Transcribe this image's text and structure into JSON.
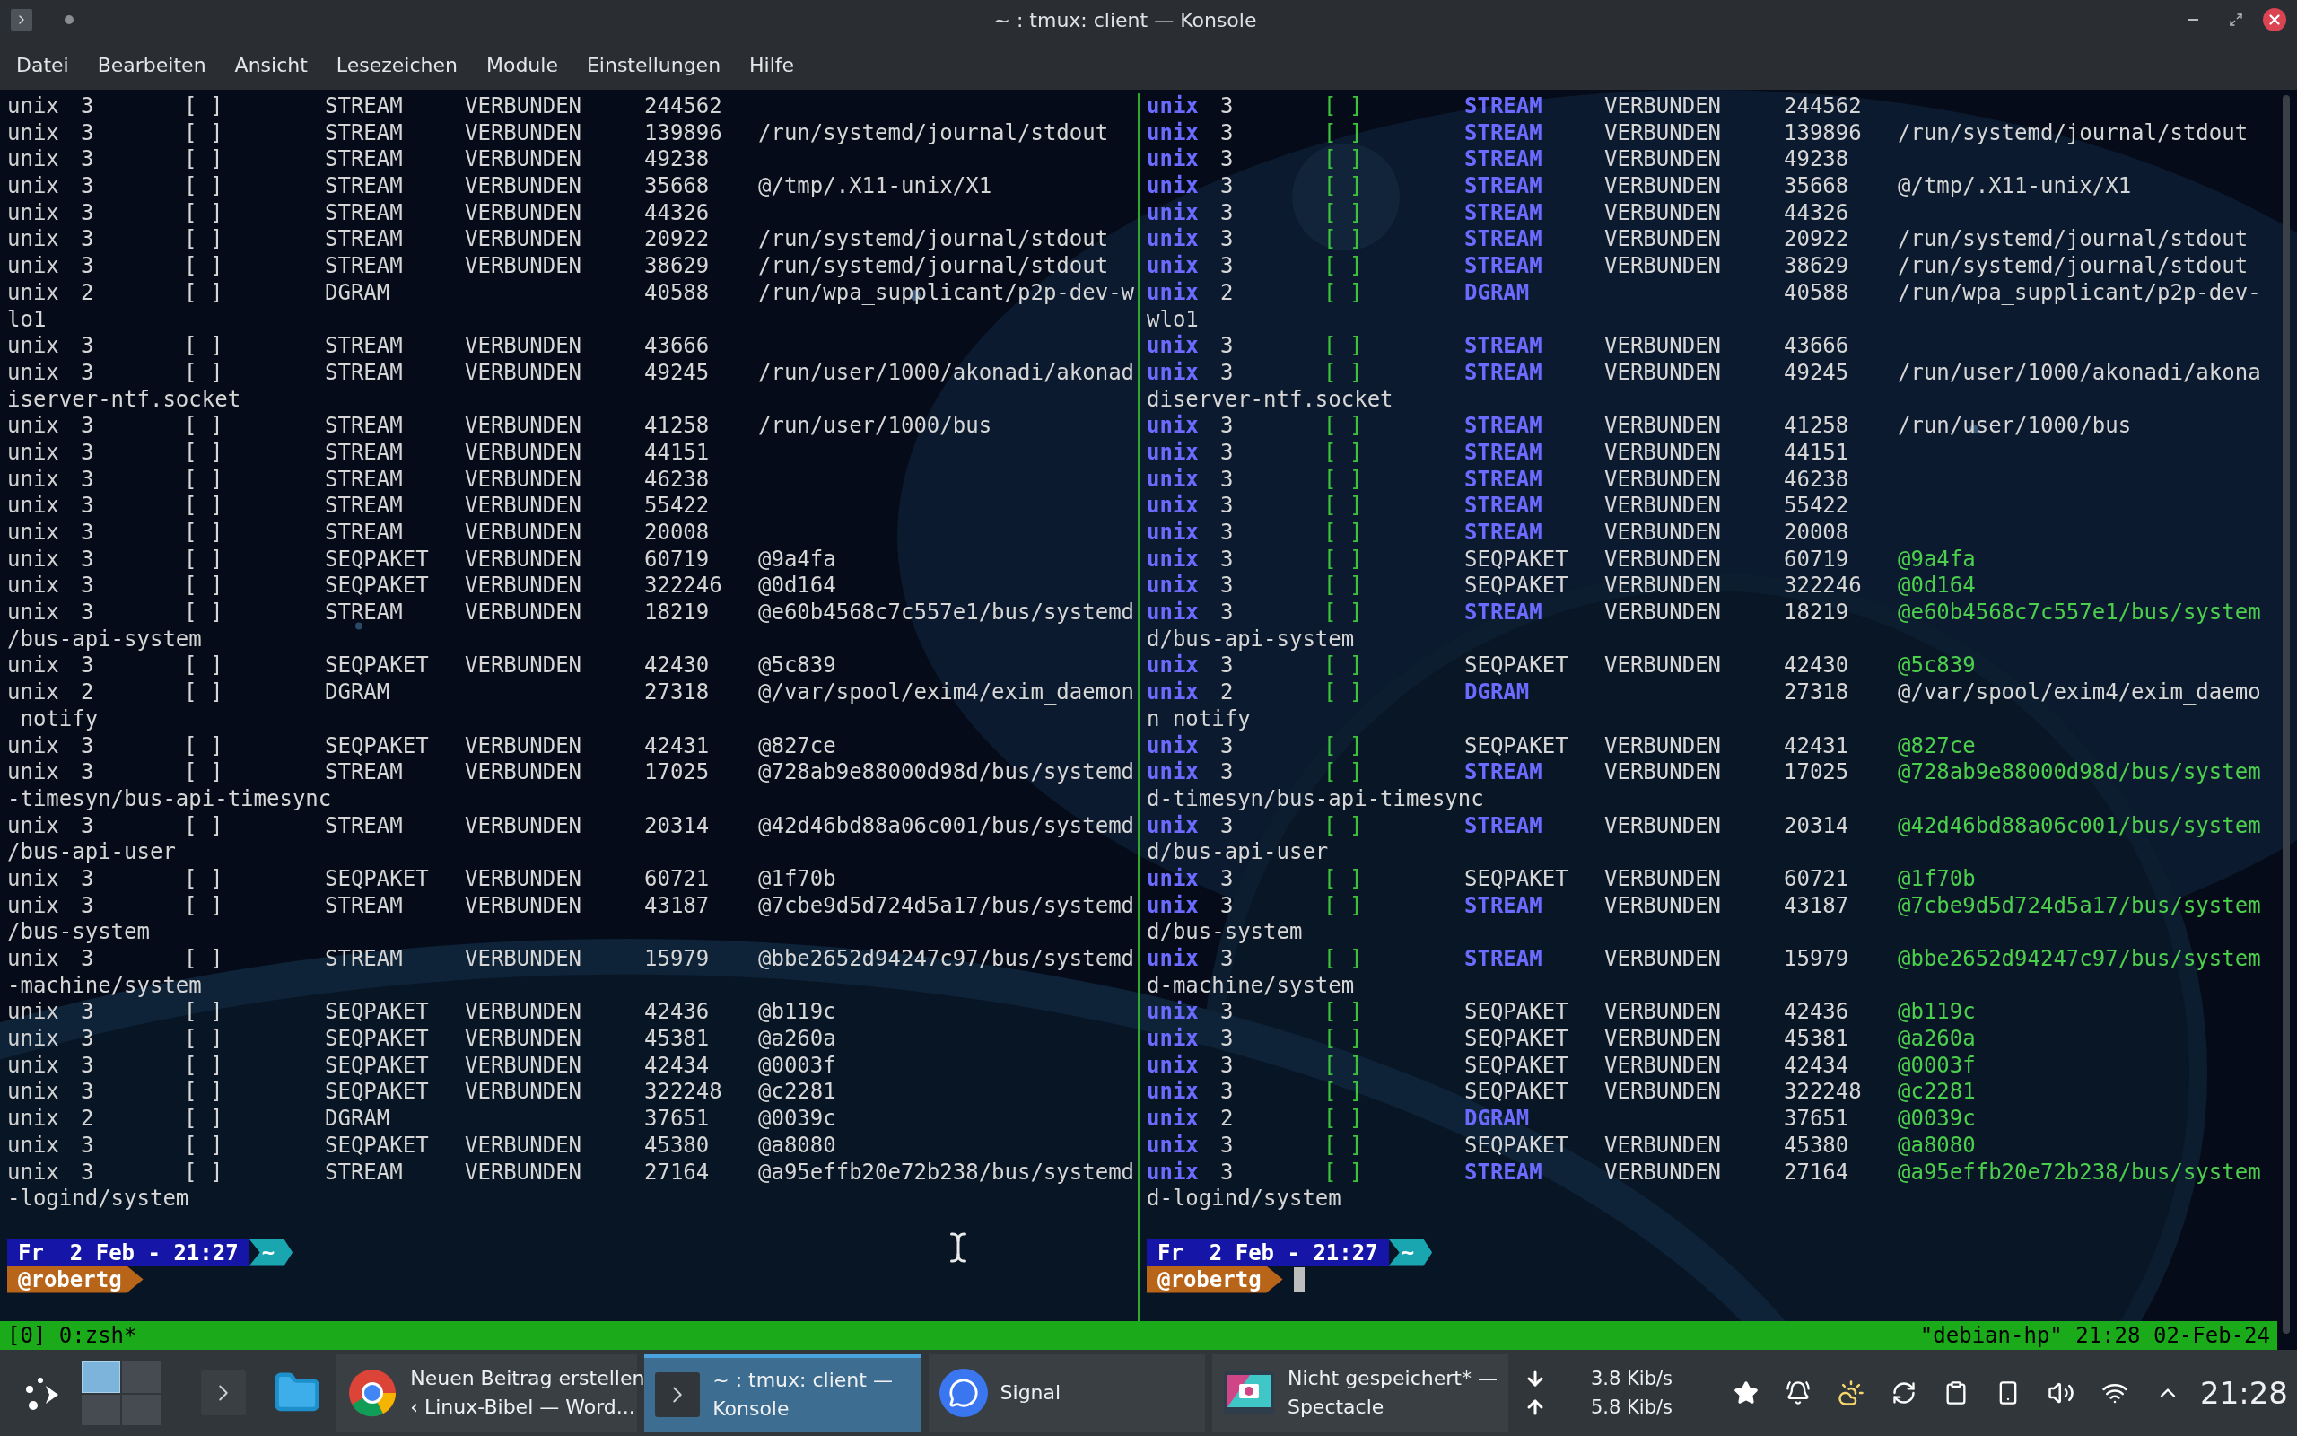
{
  "window": {
    "title": "~ : tmux: client — Konsole"
  },
  "menu": [
    "Datei",
    "Bearbeiten",
    "Ansicht",
    "Lesezeichen",
    "Module",
    "Einstellungen",
    "Hilfe"
  ],
  "panes": [
    {
      "colored": false,
      "rows": [
        {
          "proto": "unix",
          "refcnt": "3",
          "flags": "[ ]",
          "type": "STREAM",
          "state": "VERBUNDEN",
          "inode": "244562"
        },
        {
          "proto": "unix",
          "refcnt": "3",
          "flags": "[ ]",
          "type": "STREAM",
          "state": "VERBUNDEN",
          "inode": "139896",
          "path": "/run/systemd/journal/stdout"
        },
        {
          "proto": "unix",
          "refcnt": "3",
          "flags": "[ ]",
          "type": "STREAM",
          "state": "VERBUNDEN",
          "inode": "49238"
        },
        {
          "proto": "unix",
          "refcnt": "3",
          "flags": "[ ]",
          "type": "STREAM",
          "state": "VERBUNDEN",
          "inode": "35668",
          "path": "@/tmp/.X11-unix/X1"
        },
        {
          "proto": "unix",
          "refcnt": "3",
          "flags": "[ ]",
          "type": "STREAM",
          "state": "VERBUNDEN",
          "inode": "44326"
        },
        {
          "proto": "unix",
          "refcnt": "3",
          "flags": "[ ]",
          "type": "STREAM",
          "state": "VERBUNDEN",
          "inode": "20922",
          "path": "/run/systemd/journal/stdout"
        },
        {
          "proto": "unix",
          "refcnt": "3",
          "flags": "[ ]",
          "type": "STREAM",
          "state": "VERBUNDEN",
          "inode": "38629",
          "path": "/run/systemd/journal/stdout"
        },
        {
          "proto": "unix",
          "refcnt": "2",
          "flags": "[ ]",
          "type": "DGRAM",
          "inode": "40588",
          "path": "/run/wpa_supplicant/p2p-dev-w",
          "cont": "lo1"
        },
        {
          "proto": "unix",
          "refcnt": "3",
          "flags": "[ ]",
          "type": "STREAM",
          "state": "VERBUNDEN",
          "inode": "43666"
        },
        {
          "proto": "unix",
          "refcnt": "3",
          "flags": "[ ]",
          "type": "STREAM",
          "state": "VERBUNDEN",
          "inode": "49245",
          "path": "/run/user/1000/akonadi/akonad",
          "cont": "iserver-ntf.socket"
        },
        {
          "proto": "unix",
          "refcnt": "3",
          "flags": "[ ]",
          "type": "STREAM",
          "state": "VERBUNDEN",
          "inode": "41258",
          "path": "/run/user/1000/bus"
        },
        {
          "proto": "unix",
          "refcnt": "3",
          "flags": "[ ]",
          "type": "STREAM",
          "state": "VERBUNDEN",
          "inode": "44151"
        },
        {
          "proto": "unix",
          "refcnt": "3",
          "flags": "[ ]",
          "type": "STREAM",
          "state": "VERBUNDEN",
          "inode": "46238"
        },
        {
          "proto": "unix",
          "refcnt": "3",
          "flags": "[ ]",
          "type": "STREAM",
          "state": "VERBUNDEN",
          "inode": "55422"
        },
        {
          "proto": "unix",
          "refcnt": "3",
          "flags": "[ ]",
          "type": "STREAM",
          "state": "VERBUNDEN",
          "inode": "20008"
        },
        {
          "proto": "unix",
          "refcnt": "3",
          "flags": "[ ]",
          "type": "SEQPAKET",
          "state": "VERBUNDEN",
          "inode": "60719",
          "path": "@9a4fa"
        },
        {
          "proto": "unix",
          "refcnt": "3",
          "flags": "[ ]",
          "type": "SEQPAKET",
          "state": "VERBUNDEN",
          "inode": "322246",
          "path": "@0d164"
        },
        {
          "proto": "unix",
          "refcnt": "3",
          "flags": "[ ]",
          "type": "STREAM",
          "state": "VERBUNDEN",
          "inode": "18219",
          "path": "@e60b4568c7c557e1/bus/systemd",
          "cont": "/bus-api-system"
        },
        {
          "proto": "unix",
          "refcnt": "3",
          "flags": "[ ]",
          "type": "SEQPAKET",
          "state": "VERBUNDEN",
          "inode": "42430",
          "path": "@5c839"
        },
        {
          "proto": "unix",
          "refcnt": "2",
          "flags": "[ ]",
          "type": "DGRAM",
          "inode": "27318",
          "path": "@/var/spool/exim4/exim_daemon",
          "cont": "_notify"
        },
        {
          "proto": "unix",
          "refcnt": "3",
          "flags": "[ ]",
          "type": "SEQPAKET",
          "state": "VERBUNDEN",
          "inode": "42431",
          "path": "@827ce"
        },
        {
          "proto": "unix",
          "refcnt": "3",
          "flags": "[ ]",
          "type": "STREAM",
          "state": "VERBUNDEN",
          "inode": "17025",
          "path": "@728ab9e88000d98d/bus/systemd",
          "cont": "-timesyn/bus-api-timesync"
        },
        {
          "proto": "unix",
          "refcnt": "3",
          "flags": "[ ]",
          "type": "STREAM",
          "state": "VERBUNDEN",
          "inode": "20314",
          "path": "@42d46bd88a06c001/bus/systemd",
          "cont": "/bus-api-user"
        },
        {
          "proto": "unix",
          "refcnt": "3",
          "flags": "[ ]",
          "type": "SEQPAKET",
          "state": "VERBUNDEN",
          "inode": "60721",
          "path": "@1f70b"
        },
        {
          "proto": "unix",
          "refcnt": "3",
          "flags": "[ ]",
          "type": "STREAM",
          "state": "VERBUNDEN",
          "inode": "43187",
          "path": "@7cbe9d5d724d5a17/bus/systemd",
          "cont": "/bus-system"
        },
        {
          "proto": "unix",
          "refcnt": "3",
          "flags": "[ ]",
          "type": "STREAM",
          "state": "VERBUNDEN",
          "inode": "15979",
          "path": "@bbe2652d94247c97/bus/systemd",
          "cont": "-machine/system"
        },
        {
          "proto": "unix",
          "refcnt": "3",
          "flags": "[ ]",
          "type": "SEQPAKET",
          "state": "VERBUNDEN",
          "inode": "42436",
          "path": "@b119c"
        },
        {
          "proto": "unix",
          "refcnt": "3",
          "flags": "[ ]",
          "type": "SEQPAKET",
          "state": "VERBUNDEN",
          "inode": "45381",
          "path": "@a260a"
        },
        {
          "proto": "unix",
          "refcnt": "3",
          "flags": "[ ]",
          "type": "SEQPAKET",
          "state": "VERBUNDEN",
          "inode": "42434",
          "path": "@0003f"
        },
        {
          "proto": "unix",
          "refcnt": "3",
          "flags": "[ ]",
          "type": "SEQPAKET",
          "state": "VERBUNDEN",
          "inode": "322248",
          "path": "@c2281"
        },
        {
          "proto": "unix",
          "refcnt": "2",
          "flags": "[ ]",
          "type": "DGRAM",
          "inode": "37651",
          "path": "@0039c"
        },
        {
          "proto": "unix",
          "refcnt": "3",
          "flags": "[ ]",
          "type": "SEQPAKET",
          "state": "VERBUNDEN",
          "inode": "45380",
          "path": "@a8080"
        },
        {
          "proto": "unix",
          "refcnt": "3",
          "flags": "[ ]",
          "type": "STREAM",
          "state": "VERBUNDEN",
          "inode": "27164",
          "path": "@a95effb20e72b238/bus/systemd",
          "cont": "-logind/system"
        }
      ],
      "prompt": {
        "date": "Fr  2 Feb - 21:27",
        "dir": "~",
        "user": "@robertg",
        "cursor": false
      }
    },
    {
      "colored": true,
      "rows": [
        {
          "proto": "unix",
          "refcnt": "3",
          "flags": "[ ]",
          "type": "STREAM",
          "type_highlight": true,
          "state": "VERBUNDEN",
          "inode": "244562"
        },
        {
          "proto": "unix",
          "refcnt": "3",
          "flags": "[ ]",
          "type": "STREAM",
          "type_highlight": true,
          "state": "VERBUNDEN",
          "inode": "139896",
          "path": "/run/systemd/journal/stdout",
          "path_highlight": false
        },
        {
          "proto": "unix",
          "refcnt": "3",
          "flags": "[ ]",
          "type": "STREAM",
          "type_highlight": true,
          "state": "VERBUNDEN",
          "inode": "49238"
        },
        {
          "proto": "unix",
          "refcnt": "3",
          "flags": "[ ]",
          "type": "STREAM",
          "type_highlight": true,
          "state": "VERBUNDEN",
          "inode": "35668",
          "path": "@/tmp/.X11-unix/X1",
          "path_highlight": false
        },
        {
          "proto": "unix",
          "refcnt": "3",
          "flags": "[ ]",
          "type": "STREAM",
          "type_highlight": true,
          "state": "VERBUNDEN",
          "inode": "44326"
        },
        {
          "proto": "unix",
          "refcnt": "3",
          "flags": "[ ]",
          "type": "STREAM",
          "type_highlight": true,
          "state": "VERBUNDEN",
          "inode": "20922",
          "path": "/run/systemd/journal/stdout",
          "path_highlight": false
        },
        {
          "proto": "unix",
          "refcnt": "3",
          "flags": "[ ]",
          "type": "STREAM",
          "type_highlight": true,
          "state": "VERBUNDEN",
          "inode": "38629",
          "path": "/run/systemd/journal/stdout",
          "path_highlight": false
        },
        {
          "proto": "unix",
          "refcnt": "2",
          "flags": "[ ]",
          "type": "DGRAM",
          "type_highlight": true,
          "inode": "40588",
          "path": "/run/wpa_supplicant/p2p-dev-",
          "path_highlight": false,
          "cont": "wlo1"
        },
        {
          "proto": "unix",
          "refcnt": "3",
          "flags": "[ ]",
          "type": "STREAM",
          "type_highlight": true,
          "state": "VERBUNDEN",
          "inode": "43666"
        },
        {
          "proto": "unix",
          "refcnt": "3",
          "flags": "[ ]",
          "type": "STREAM",
          "type_highlight": true,
          "state": "VERBUNDEN",
          "inode": "49245",
          "path": "/run/user/1000/akonadi/akona",
          "path_highlight": false,
          "cont": "diserver-ntf.socket"
        },
        {
          "proto": "unix",
          "refcnt": "3",
          "flags": "[ ]",
          "type": "STREAM",
          "type_highlight": true,
          "state": "VERBUNDEN",
          "inode": "41258",
          "path": "/run/user/1000/bus",
          "path_highlight": false
        },
        {
          "proto": "unix",
          "refcnt": "3",
          "flags": "[ ]",
          "type": "STREAM",
          "type_highlight": true,
          "state": "VERBUNDEN",
          "inode": "44151"
        },
        {
          "proto": "unix",
          "refcnt": "3",
          "flags": "[ ]",
          "type": "STREAM",
          "type_highlight": true,
          "state": "VERBUNDEN",
          "inode": "46238"
        },
        {
          "proto": "unix",
          "refcnt": "3",
          "flags": "[ ]",
          "type": "STREAM",
          "type_highlight": true,
          "state": "VERBUNDEN",
          "inode": "55422"
        },
        {
          "proto": "unix",
          "refcnt": "3",
          "flags": "[ ]",
          "type": "STREAM",
          "type_highlight": true,
          "state": "VERBUNDEN",
          "inode": "20008"
        },
        {
          "proto": "unix",
          "refcnt": "3",
          "flags": "[ ]",
          "type": "SEQPAKET",
          "type_highlight": false,
          "state": "VERBUNDEN",
          "inode": "60719",
          "path": "@9a4fa",
          "path_highlight": true
        },
        {
          "proto": "unix",
          "refcnt": "3",
          "flags": "[ ]",
          "type": "SEQPAKET",
          "type_highlight": false,
          "state": "VERBUNDEN",
          "inode": "322246",
          "path": "@0d164",
          "path_highlight": true
        },
        {
          "proto": "unix",
          "refcnt": "3",
          "flags": "[ ]",
          "type": "STREAM",
          "type_highlight": true,
          "state": "VERBUNDEN",
          "inode": "18219",
          "path": "@e60b4568c7c557e1/bus/system",
          "path_highlight": true,
          "cont": "d/bus-api-system"
        },
        {
          "proto": "unix",
          "refcnt": "3",
          "flags": "[ ]",
          "type": "SEQPAKET",
          "type_highlight": false,
          "state": "VERBUNDEN",
          "inode": "42430",
          "path": "@5c839",
          "path_highlight": true
        },
        {
          "proto": "unix",
          "refcnt": "2",
          "flags": "[ ]",
          "type": "DGRAM",
          "type_highlight": true,
          "inode": "27318",
          "path": "@/var/spool/exim4/exim_daemo",
          "path_highlight": false,
          "cont": "n_notify"
        },
        {
          "proto": "unix",
          "refcnt": "3",
          "flags": "[ ]",
          "type": "SEQPAKET",
          "type_highlight": false,
          "state": "VERBUNDEN",
          "inode": "42431",
          "path": "@827ce",
          "path_highlight": true
        },
        {
          "proto": "unix",
          "refcnt": "3",
          "flags": "[ ]",
          "type": "STREAM",
          "type_highlight": true,
          "state": "VERBUNDEN",
          "inode": "17025",
          "path": "@728ab9e88000d98d/bus/system",
          "path_highlight": true,
          "cont": "d-timesyn/bus-api-timesync"
        },
        {
          "proto": "unix",
          "refcnt": "3",
          "flags": "[ ]",
          "type": "STREAM",
          "type_highlight": true,
          "state": "VERBUNDEN",
          "inode": "20314",
          "path": "@42d46bd88a06c001/bus/system",
          "path_highlight": true,
          "cont": "d/bus-api-user"
        },
        {
          "proto": "unix",
          "refcnt": "3",
          "flags": "[ ]",
          "type": "SEQPAKET",
          "type_highlight": false,
          "state": "VERBUNDEN",
          "inode": "60721",
          "path": "@1f70b",
          "path_highlight": true
        },
        {
          "proto": "unix",
          "refcnt": "3",
          "flags": "[ ]",
          "type": "STREAM",
          "type_highlight": true,
          "state": "VERBUNDEN",
          "inode": "43187",
          "path": "@7cbe9d5d724d5a17/bus/system",
          "path_highlight": true,
          "cont": "d/bus-system"
        },
        {
          "proto": "unix",
          "refcnt": "3",
          "flags": "[ ]",
          "type": "STREAM",
          "type_highlight": true,
          "state": "VERBUNDEN",
          "inode": "15979",
          "path": "@bbe2652d94247c97/bus/system",
          "path_highlight": true,
          "cont": "d-machine/system"
        },
        {
          "proto": "unix",
          "refcnt": "3",
          "flags": "[ ]",
          "type": "SEQPAKET",
          "type_highlight": false,
          "state": "VERBUNDEN",
          "inode": "42436",
          "path": "@b119c",
          "path_highlight": true
        },
        {
          "proto": "unix",
          "refcnt": "3",
          "flags": "[ ]",
          "type": "SEQPAKET",
          "type_highlight": false,
          "state": "VERBUNDEN",
          "inode": "45381",
          "path": "@a260a",
          "path_highlight": true
        },
        {
          "proto": "unix",
          "refcnt": "3",
          "flags": "[ ]",
          "type": "SEQPAKET",
          "type_highlight": false,
          "state": "VERBUNDEN",
          "inode": "42434",
          "path": "@0003f",
          "path_highlight": true
        },
        {
          "proto": "unix",
          "refcnt": "3",
          "flags": "[ ]",
          "type": "SEQPAKET",
          "type_highlight": false,
          "state": "VERBUNDEN",
          "inode": "322248",
          "path": "@c2281",
          "path_highlight": true
        },
        {
          "proto": "unix",
          "refcnt": "2",
          "flags": "[ ]",
          "type": "DGRAM",
          "type_highlight": true,
          "inode": "37651",
          "path": "@0039c",
          "path_highlight": true
        },
        {
          "proto": "unix",
          "refcnt": "3",
          "flags": "[ ]",
          "type": "SEQPAKET",
          "type_highlight": false,
          "state": "VERBUNDEN",
          "inode": "45380",
          "path": "@a8080",
          "path_highlight": true
        },
        {
          "proto": "unix",
          "refcnt": "3",
          "flags": "[ ]",
          "type": "STREAM",
          "type_highlight": true,
          "state": "VERBUNDEN",
          "inode": "27164",
          "path": "@a95effb20e72b238/bus/system",
          "path_highlight": true,
          "cont": "d-logind/system"
        }
      ],
      "prompt": {
        "date": "Fr  2 Feb - 21:27",
        "dir": "~",
        "user": "@robertg",
        "cursor": true
      }
    }
  ],
  "status_bar": {
    "left": "[0] 0:zsh*",
    "right": "\"debian-hp\" 21:28 02-Feb-24"
  },
  "taskbar": {
    "tasks": [
      {
        "kind": "browser",
        "line1": "Neuen Beitrag erstellen",
        "line2": "‹ Linux-Bibel — Word...",
        "selected": false
      },
      {
        "kind": "terminal",
        "line1": "~ : tmux: client —",
        "line2": "Konsole",
        "selected": true
      },
      {
        "kind": "chat",
        "line1": "Signal",
        "selected": false
      },
      {
        "kind": "screenshot",
        "line1": "Nicht gespeichert* —",
        "line2": "Spectacle",
        "selected": false
      }
    ],
    "net_down": "3.8 Kib/s",
    "net_up": "5.8 Kib/s",
    "clock": "21:28"
  }
}
